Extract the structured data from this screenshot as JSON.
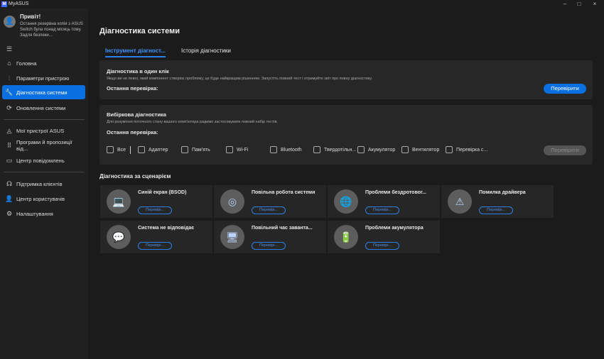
{
  "window": {
    "title": "MyASUS",
    "controls": [
      "–",
      "□",
      "×"
    ]
  },
  "sidebar": {
    "greeting": "Привіт!",
    "note": "Остання резервна копія з ASUS Switch була понад місяць тому. Задля безпеки...",
    "items": [
      {
        "label": "Головна",
        "icon": "home-icon",
        "glyph": "⌂"
      },
      {
        "label": "Параметри пристрою",
        "icon": "sliders-icon",
        "glyph": "⫶"
      },
      {
        "label": "Діагностика системи",
        "icon": "wrench-icon",
        "glyph": "🔧"
      },
      {
        "label": "Оновлення системи",
        "icon": "refresh-icon",
        "glyph": "⟳"
      },
      {
        "label": "Мої пристрої ASUS",
        "icon": "devices-icon",
        "glyph": "◬"
      },
      {
        "label": "Програми й пропозиції від...",
        "icon": "grid-icon",
        "glyph": "⠿"
      },
      {
        "label": "Центр повідомлень",
        "icon": "message-icon",
        "glyph": "▭"
      },
      {
        "label": "Підтримка клієнтів",
        "icon": "headset-icon",
        "glyph": "☊"
      },
      {
        "label": "Центр користувачів",
        "icon": "user-icon",
        "glyph": "👤"
      },
      {
        "label": "Налаштування",
        "icon": "gear-icon",
        "glyph": "⚙"
      }
    ],
    "active_index": 2
  },
  "main": {
    "title": "Діагностика системи",
    "tabs": [
      "Інструмент діагност...",
      "Історія діагностики"
    ],
    "one_click": {
      "title": "Діагностика в один клік",
      "desc": "Якщо ви не певні, який компонент створює проблему, це буде найкращим рішенням. Запустіть повний тест і отримуйте звіт про повну діагностику.",
      "last_check": "Остання перевірка:",
      "button": "Перевірити"
    },
    "selective": {
      "title": "Вибіркова діагностика",
      "desc": "Для розуміння поточного стану вашого комп'ютера радимо застосовувати повний набір тестів.",
      "last_check": "Остання перевірка:",
      "button": "Перевірити",
      "options": [
        "Все",
        "Адаптер",
        "Пам'ять",
        "Wi-Fi",
        "Bluetooth",
        "Твердотільн...",
        "Акумулятор",
        "Вентилятор",
        "Перевірка с..."
      ]
    },
    "scenario": {
      "title": "Діагностика за сценарієм",
      "button": "Перевірі...",
      "tiles": [
        {
          "title": "Синій екран (BSOD)",
          "icon": "laptop-bsod-icon",
          "glyph": "💻"
        },
        {
          "title": "Повільна робота системи",
          "icon": "speedometer-icon",
          "glyph": "◎"
        },
        {
          "title": "Проблеми бездротовог...",
          "icon": "globe-icon",
          "glyph": "🌐"
        },
        {
          "title": "Помилка драйвера",
          "icon": "driver-warning-icon",
          "glyph": "⚠"
        },
        {
          "title": "Система не відповідає",
          "icon": "chat-screen-icon",
          "glyph": "💬"
        },
        {
          "title": "Повільний час заванта...",
          "icon": "screen-clock-icon",
          "glyph": "🖥"
        },
        {
          "title": "Проблеми акумулятора",
          "icon": "battery-icon",
          "glyph": "🔋"
        }
      ]
    }
  }
}
